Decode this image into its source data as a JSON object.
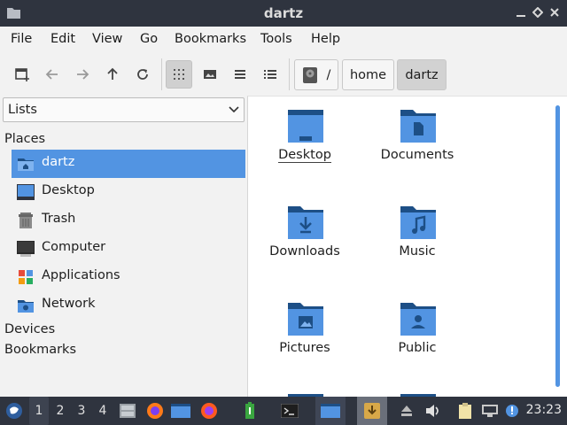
{
  "window": {
    "title": "dartz"
  },
  "menubar": {
    "items": [
      "File",
      "Edit",
      "View",
      "Go",
      "Bookmarks",
      "Tools",
      "Help"
    ]
  },
  "toolbar": {
    "breadcrumbs": [
      "/",
      "home",
      "dartz"
    ]
  },
  "sidebar": {
    "view_select": "Lists",
    "sections": {
      "places": "Places",
      "devices": "Devices",
      "bookmarks": "Bookmarks"
    },
    "places": [
      {
        "label": "dartz",
        "icon": "home-folder-icon",
        "selected": true
      },
      {
        "label": "Desktop",
        "icon": "desktop-icon"
      },
      {
        "label": "Trash",
        "icon": "trash-icon"
      },
      {
        "label": "Computer",
        "icon": "computer-icon"
      },
      {
        "label": "Applications",
        "icon": "applications-icon"
      },
      {
        "label": "Network",
        "icon": "network-icon"
      }
    ]
  },
  "files": [
    {
      "label": "Desktop",
      "icon": "desktop-folder-icon"
    },
    {
      "label": "Documents",
      "icon": "documents-folder-icon"
    },
    {
      "label": "Downloads",
      "icon": "downloads-folder-icon"
    },
    {
      "label": "Music",
      "icon": "music-folder-icon"
    },
    {
      "label": "Pictures",
      "icon": "pictures-folder-icon"
    },
    {
      "label": "Public",
      "icon": "public-folder-icon"
    }
  ],
  "taskbar": {
    "workspaces": [
      "1",
      "2",
      "3",
      "4"
    ],
    "active_workspace": "1",
    "clock": "23:23"
  },
  "colors": {
    "accent": "#5294e2",
    "titlebar": "#2f343f",
    "folder": "#5294e2",
    "folder_dark": "#1d4f86"
  }
}
